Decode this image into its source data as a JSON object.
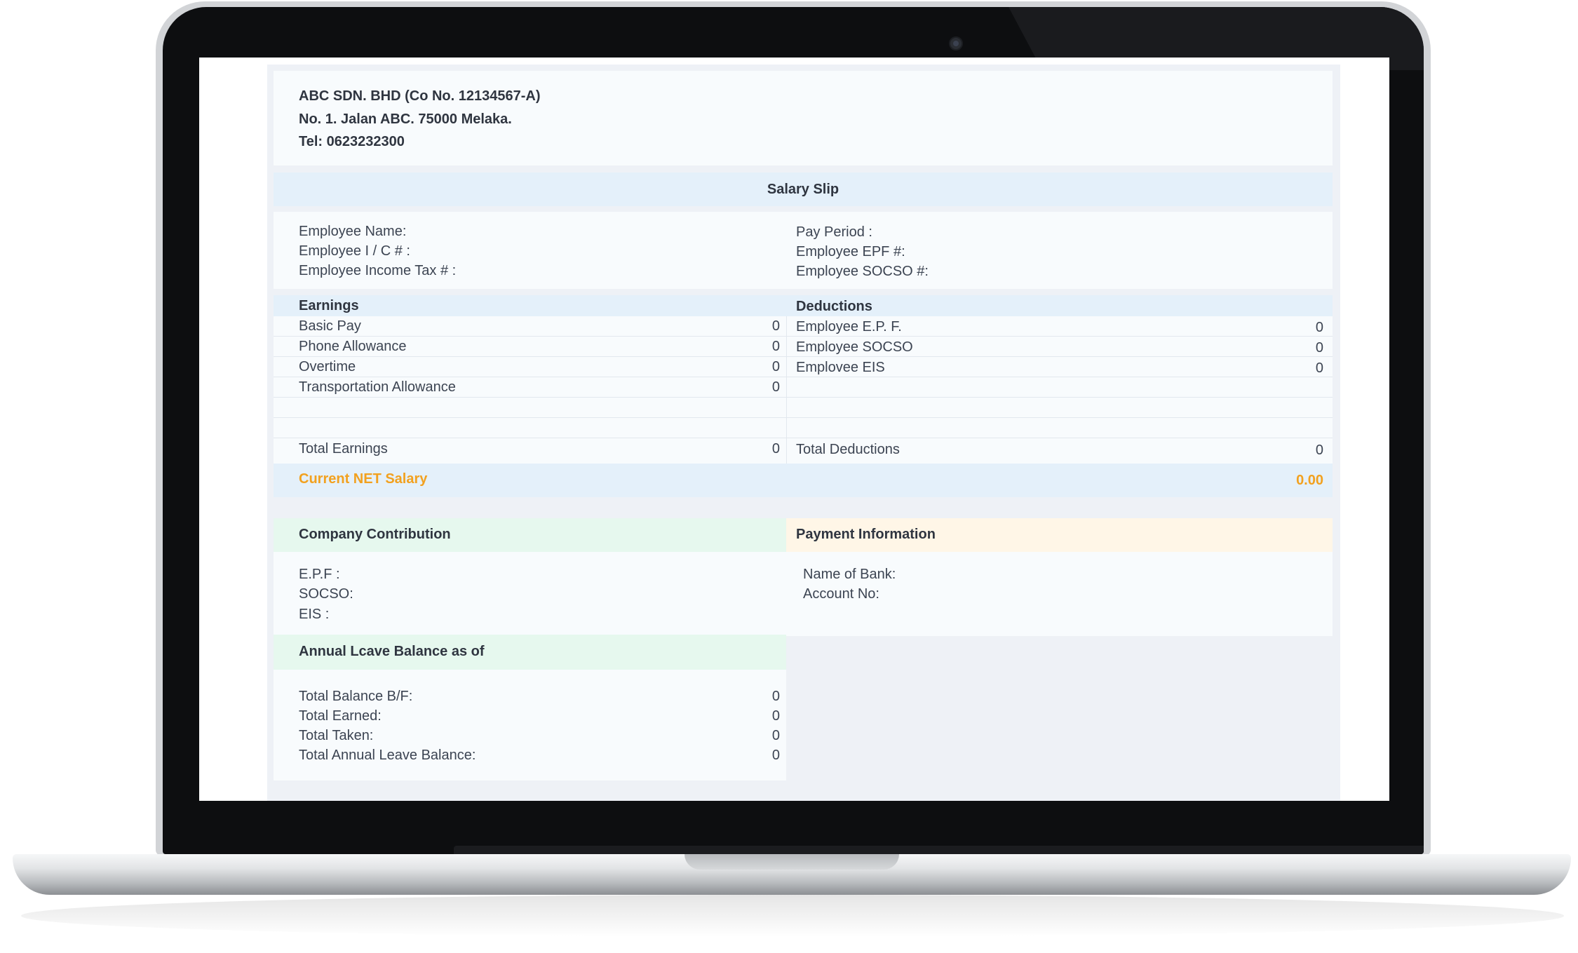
{
  "company": {
    "name": "ABC SDN. BHD (Co No. 12134567-A)",
    "address": "No. 1. Jalan ABC. 75000 Melaka.",
    "tel": "Tel: 0623232300"
  },
  "slip_title": "Salary Slip",
  "employee_info": {
    "left": [
      "Employee Name:",
      "Employee I / C # :",
      "Employee Income Tax # :"
    ],
    "right": [
      "Pay Period :",
      "Employee EPF #:",
      "Employee SOCSO #:"
    ]
  },
  "earnings": {
    "header": "Earnings",
    "items": [
      {
        "label": "Basic Pay",
        "value": "0"
      },
      {
        "label": "Phone Allowance",
        "value": "0"
      },
      {
        "label": "Overtime",
        "value": "0"
      },
      {
        "label": "Transportation Allowance",
        "value": "0"
      }
    ],
    "total_label": "Total Earnings",
    "total_value": "0"
  },
  "deductions": {
    "header": "Deductions",
    "items": [
      {
        "label": "Employee E.P. F.",
        "value": "0"
      },
      {
        "label": "Employee SOCSO",
        "value": "0"
      },
      {
        "label": "Emplovee EIS",
        "value": "0"
      }
    ],
    "total_label": "Total Deductions",
    "total_value": "0"
  },
  "net_salary": {
    "label": "Current NET Salary",
    "value": "0.00"
  },
  "company_contribution": {
    "header": "Company Contribution",
    "items": [
      "E.P.F :",
      "SOCSO:",
      "EIS :"
    ]
  },
  "payment_information": {
    "header": "Payment Information",
    "items": [
      "Name of Bank:",
      "Account No:"
    ]
  },
  "leave_balance": {
    "header": "Annual Lcave Balance as of",
    "items": [
      {
        "label": "Total Balance B/F:",
        "value": "0"
      },
      {
        "label": "Total Earned:",
        "value": "0"
      },
      {
        "label": "Total Taken:",
        "value": "0"
      },
      {
        "label": "Total Annual Leave Balance:",
        "value": "0"
      }
    ]
  },
  "colors": {
    "accent_orange": "#f2a11f",
    "band_blue": "#e4f0fa",
    "band_green": "#e6f8ee",
    "band_cream": "#fff6e7"
  }
}
